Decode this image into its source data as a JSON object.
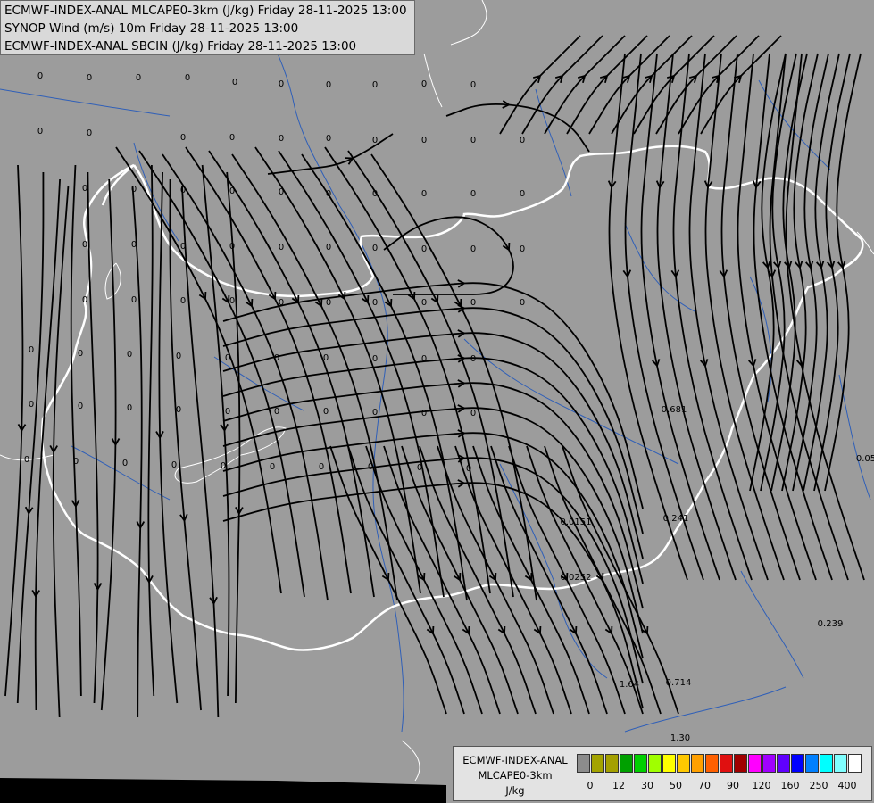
{
  "title_lines": [
    "ECMWF-INDEX-ANAL MLCAPE0-3km (J/kg) Friday 28-11-2025 13:00",
    "SYNOP Wind (m/s) 10m Friday 28-11-2025 13:00",
    "ECMWF-INDEX-ANAL SBCIN (J/kg) Friday 28-11-2025 13:00"
  ],
  "legend": {
    "label_lines": [
      "ECMWF-INDEX-ANAL",
      "MLCAPE0-3km",
      "J/kg"
    ],
    "colors": [
      "#8c8c8c",
      "#a3a300",
      "#a4a000",
      "#00a000",
      "#00d000",
      "#a0ff00",
      "#ffff00",
      "#ffc800",
      "#ffa000",
      "#ff6000",
      "#e01010",
      "#a00000",
      "#ff00ff",
      "#a000ff",
      "#6000ff",
      "#0000ff",
      "#0080ff",
      "#00ffff",
      "#80ffff",
      "#ffffff"
    ],
    "ticks": [
      "0",
      "12",
      "30",
      "50",
      "70",
      "90",
      "120",
      "160",
      "250",
      "400"
    ]
  },
  "map": {
    "background": "#9c9c9c",
    "border_color": "#ffffff",
    "river_color": "#2f5fb8",
    "streamline_color": "#000000",
    "value_labels": [
      "0",
      "0",
      "0",
      "0",
      "0",
      "0",
      "0",
      "0",
      "0",
      "0",
      "0",
      "0",
      "0",
      "0",
      "0",
      "0",
      "0",
      "0",
      "0",
      "0",
      "0",
      "0",
      "0",
      "0",
      "0",
      "0",
      "0",
      "0",
      "0",
      "0",
      "0",
      "0",
      "0",
      "0",
      "0",
      "0",
      "0",
      "0",
      "0",
      "0",
      "0",
      "0",
      "0",
      "0",
      "0",
      "0",
      "0",
      "0",
      "0",
      "0",
      "0",
      "0",
      "0",
      "0",
      "0",
      "0",
      "0",
      "0",
      "0",
      "0",
      "0",
      "0",
      "0",
      "0",
      "0",
      "0",
      "0",
      "0",
      "0",
      "0",
      "0",
      "0",
      "0",
      "0",
      "0",
      "0",
      "0",
      "0",
      "0",
      "0",
      "0.681",
      "0.0151",
      "0.241",
      "0.0252",
      "0.239",
      "1.64",
      "0.714",
      "1.30",
      "0.05"
    ]
  }
}
